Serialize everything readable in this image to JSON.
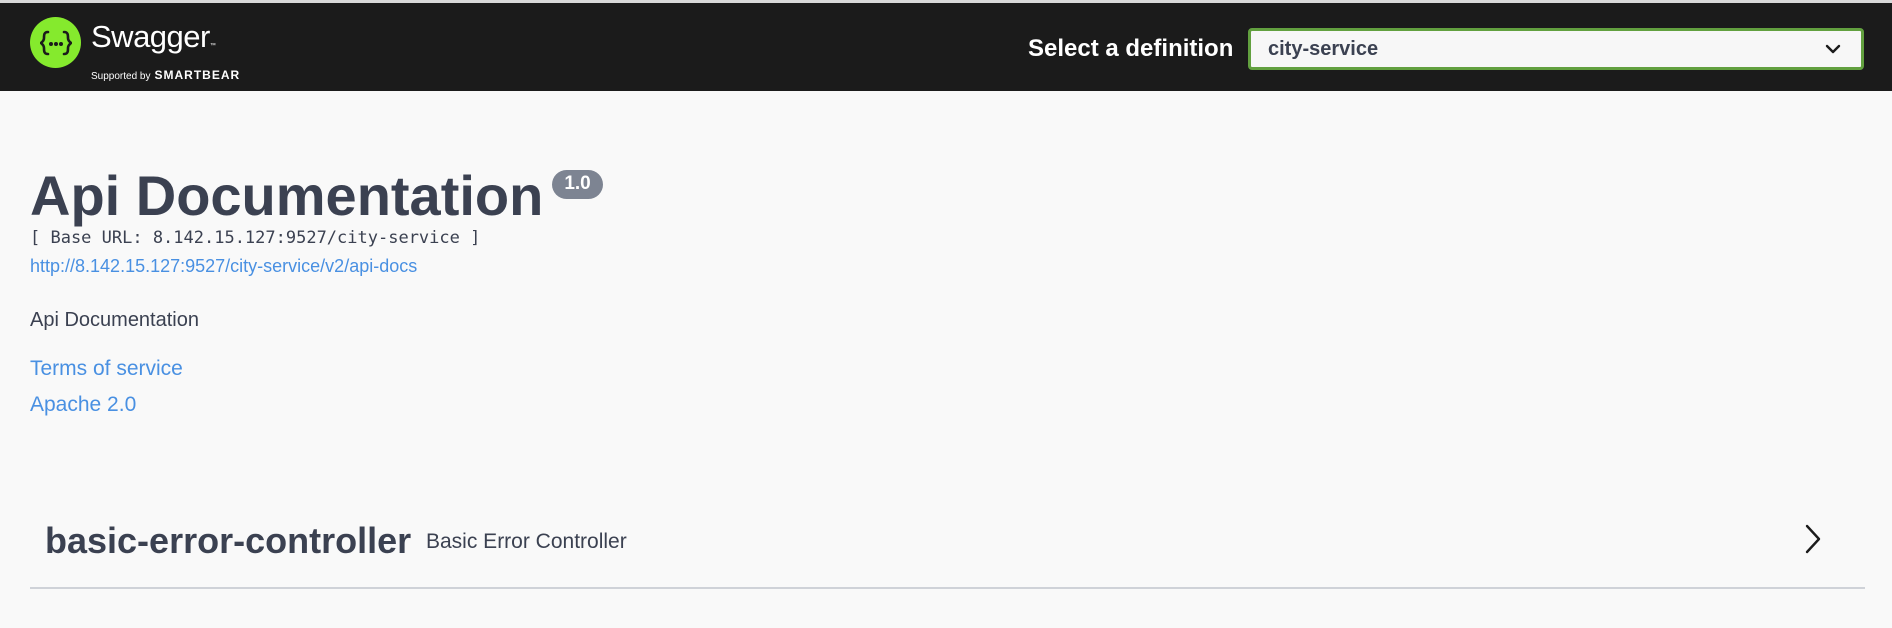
{
  "topbar": {
    "logo_name": "Swagger",
    "logo_tm": "™",
    "logo_supported": "Supported by",
    "logo_smartbear": "SMARTBEAR",
    "select_label": "Select a definition",
    "selected_definition": "city-service",
    "background_color": "#1b1b1b",
    "logo_color": "#85ea2d",
    "select_border_color": "#62a03f"
  },
  "info": {
    "title": "Api Documentation",
    "version": "1.0",
    "base_url": "[ Base URL: 8.142.15.127:9527/city-service ]",
    "docs_url": "http://8.142.15.127:9527/city-service/v2/api-docs",
    "description": "Api Documentation",
    "terms_of_service": "Terms of service",
    "license": "Apache 2.0",
    "link_color": "#4990e2",
    "text_color": "#3b4151"
  },
  "tags": [
    {
      "name": "basic-error-controller",
      "description": "Basic Error Controller",
      "expand_icon": "chevron-right-icon"
    }
  ]
}
